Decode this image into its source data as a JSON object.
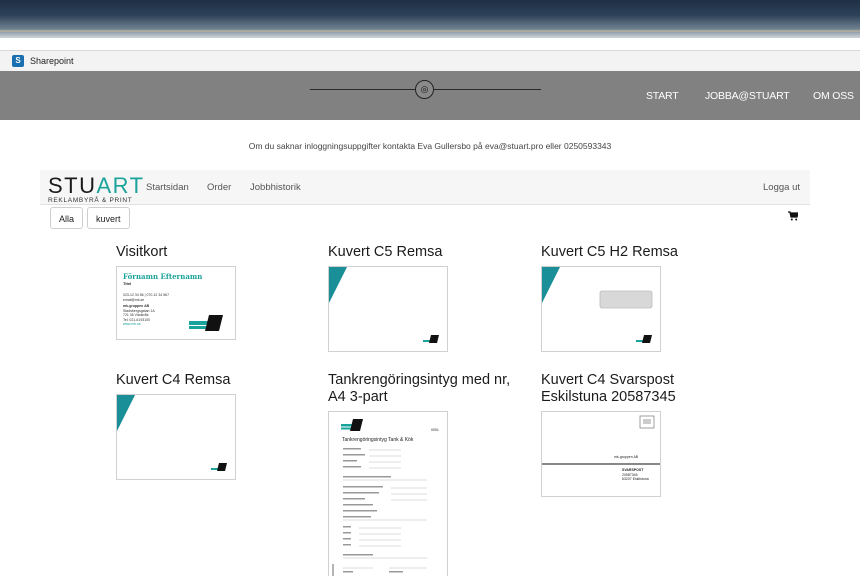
{
  "browser": {
    "favorite_label": "Sharepoint",
    "favorite_icon": "sharepoint-icon"
  },
  "topnav": {
    "logo_icon": "circle-emblem-icon",
    "links": [
      "START",
      "JOBBA@STUART",
      "OM OSS"
    ]
  },
  "notice": "Om du saknar inloggningsuppgifter kontakta Eva Gullersbo på eva@stuart.pro eller 0250593343",
  "brand": {
    "name_part1": "STU",
    "name_part2": "ART",
    "tagline": "REKLAMBYRÅ & PRINT",
    "accent_color": "#1aa39a"
  },
  "appnav": {
    "links": [
      "Startsidan",
      "Order",
      "Jobbhistorik"
    ],
    "logout": "Logga ut",
    "cart_icon": "shopping-cart-icon"
  },
  "filters": [
    "Alla",
    "kuvert"
  ],
  "products": [
    {
      "title": "Visitkort"
    },
    {
      "title": "Kuvert C5 Remsa"
    },
    {
      "title": "Kuvert C5 H2 Remsa"
    },
    {
      "title": "Kuvert C4 Remsa"
    },
    {
      "title": "Tankrengöringsintyg med nr, A4 3-part"
    },
    {
      "title": "Kuvert C4 Svarspost Eskilstuna 20587345"
    }
  ],
  "card_preview": {
    "name": "Förnamn Efternamn",
    "role": "Titel",
    "phone": "023-12 34 56 | 070-12 34 567",
    "email": "email@mk.se",
    "company": "mk-gruppen AB",
    "street": "Stadsbergsgatan 1A",
    "city": "721 36 Västerås",
    "fax": "Tel: 021-6193100",
    "web": "www.mk.se"
  },
  "form_preview": {
    "number": "0001",
    "title": "Tankrengöringsintyg Tank & Kök"
  },
  "reply_preview": {
    "sender": "mk-gruppen AB",
    "recipient": "SVARSPOST",
    "recipient_line2": "20587345",
    "recipient_line3": "63207 Eskilstuna"
  }
}
